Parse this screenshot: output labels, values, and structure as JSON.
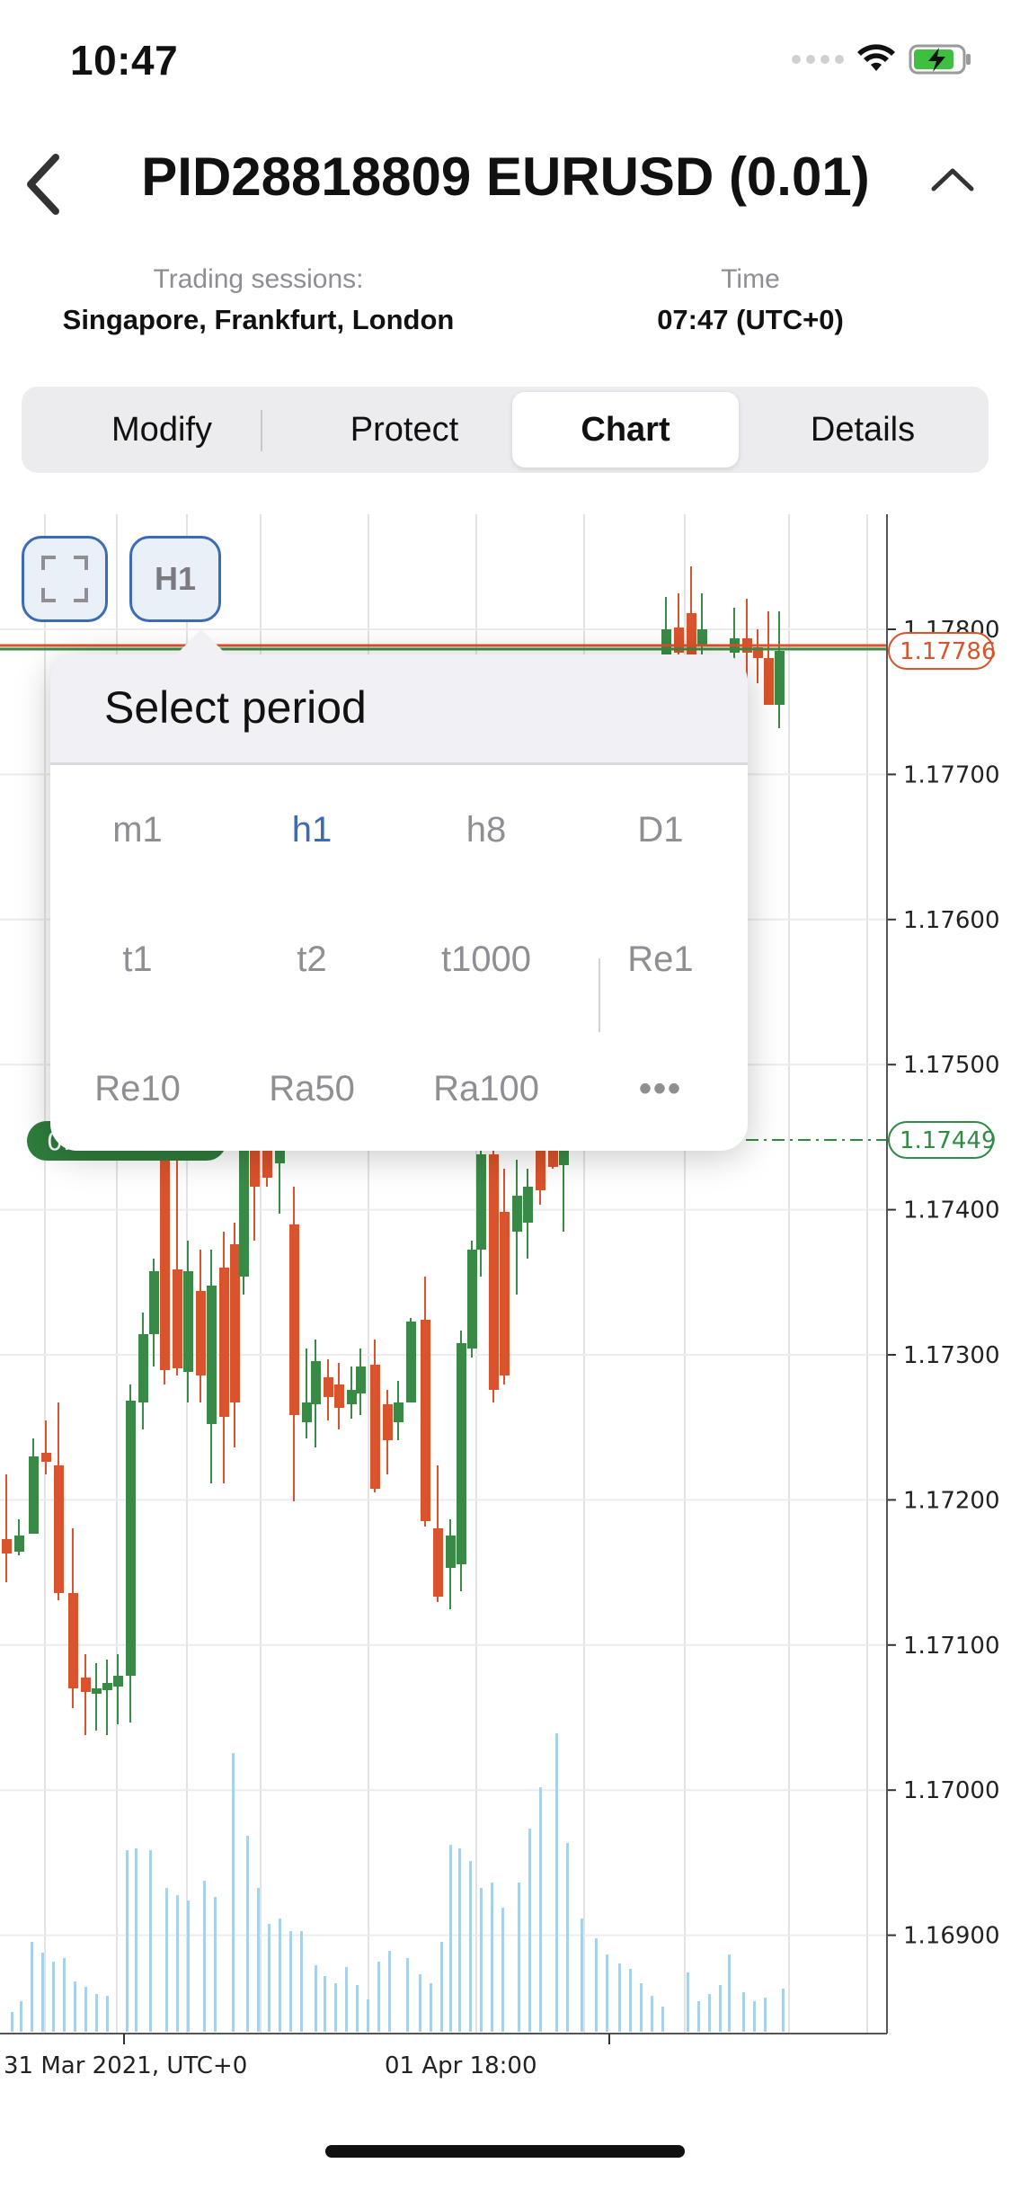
{
  "status_bar": {
    "time": "10:47"
  },
  "header": {
    "title": "PID28818809 EURUSD (0.01)"
  },
  "sessions": {
    "trading_label": "Trading sessions:",
    "trading_value": "Singapore, Frankfurt, London",
    "time_label": "Time",
    "time_value": "07:47 (UTC+0)"
  },
  "tabs": [
    {
      "label": "Modify"
    },
    {
      "label": "Protect"
    },
    {
      "label": "Chart"
    },
    {
      "label": "Details"
    }
  ],
  "active_tab": "Chart",
  "chart_controls": {
    "period_button": "H1"
  },
  "period_popup": {
    "title": "Select period",
    "options": [
      "m1",
      "h1",
      "h8",
      "D1",
      "t1",
      "t2",
      "t1000",
      "Re1",
      "Re10",
      "Ra50",
      "Ra100"
    ],
    "selected": "h1",
    "more": "•••"
  },
  "chart_data": {
    "type": "candlestick",
    "y_ticks": [
      "1.17800",
      "1.17700",
      "1.17600",
      "1.17500",
      "1.17400",
      "1.17300",
      "1.17200",
      "1.17100",
      "1.17000",
      "1.16900"
    ],
    "x_ticks": [
      "31 Mar 2021, UTC+0",
      "01 Apr 18:00"
    ],
    "price_tags": [
      {
        "value": "1.17786",
        "color": "#d9532c"
      },
      {
        "value": "1.17449",
        "color": "#2e8b44"
      }
    ],
    "position_label_partial": "0.",
    "colors": {
      "up": "#3a8a47",
      "down": "#d9532c",
      "volume": "#a9d2ea",
      "current_price_line": "#3a8a47"
    }
  }
}
